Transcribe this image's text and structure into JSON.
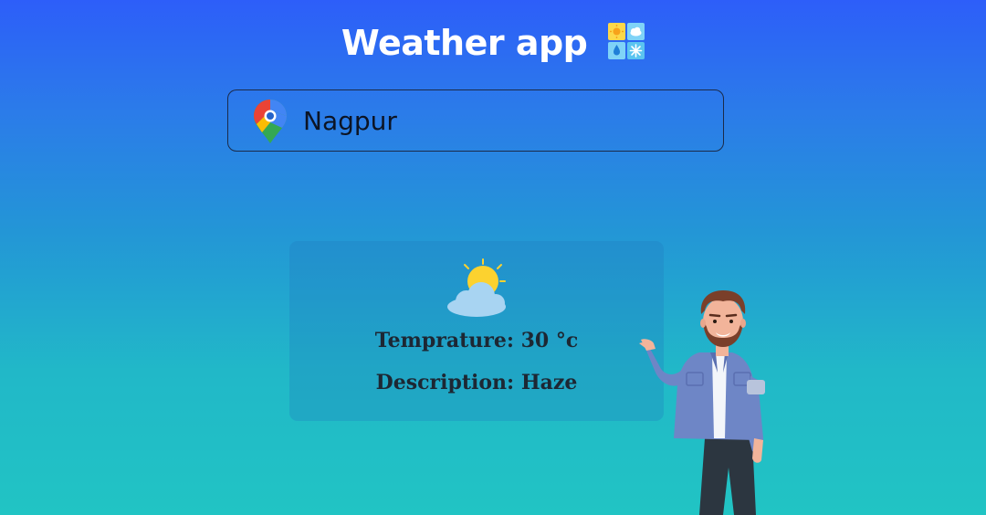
{
  "app": {
    "title": "Weather app",
    "title_icon": "weather-tiles-icon"
  },
  "search": {
    "value": "Nagpur",
    "icon": "map-pin-icon"
  },
  "weather": {
    "icon": "sun-behind-cloud-icon",
    "temperature_label": "Temprature: 30 °c",
    "description_label": "Description: Haze"
  },
  "colors": {
    "background_top": "#2d5ef9",
    "background_bottom": "#21c4c4",
    "title_text": "#ffffff",
    "card_text": "#1d2733",
    "sun": "#fcd22f",
    "cloud": "#a8d4f2"
  }
}
